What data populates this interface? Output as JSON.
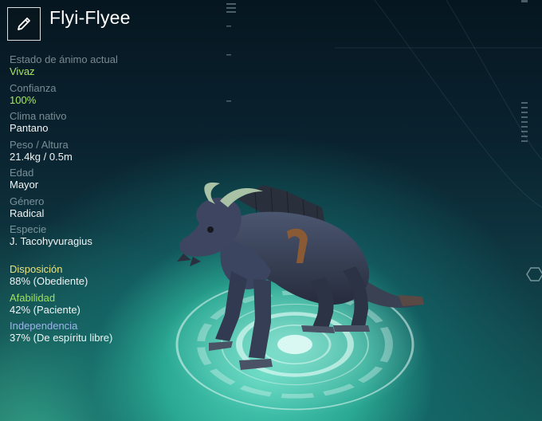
{
  "header": {
    "edit_icon": "pencil-icon",
    "creature_name": "Flyi-Flyee"
  },
  "stats": [
    {
      "label": "Estado de ánimo actual",
      "value": "Vivaz",
      "highlight": true
    },
    {
      "label": "Confianza",
      "value": "100%",
      "highlight": true
    },
    {
      "label": "Clima nativo",
      "value": "Pantano",
      "highlight": false
    },
    {
      "label": "Peso / Altura",
      "value": "21.4kg / 0.5m",
      "highlight": false
    },
    {
      "label": "Edad",
      "value": "Mayor",
      "highlight": false
    },
    {
      "label": "Género",
      "value": "Radical",
      "highlight": false
    },
    {
      "label": "Especie",
      "value": "J. Tacohyvuragius",
      "highlight": false
    }
  ],
  "traits": [
    {
      "label": "Disposición",
      "value": "88% (Obediente)",
      "color": "#e9e27a"
    },
    {
      "label": "Afabilidad",
      "value": "42% (Paciente)",
      "color": "#9fe062"
    },
    {
      "label": "Independencia",
      "value": "37% (De espíritu libre)",
      "color": "#9fb4ee"
    }
  ],
  "colors": {
    "highlight_green": "#a6e85c",
    "label_gray": "#8fa3a8"
  }
}
